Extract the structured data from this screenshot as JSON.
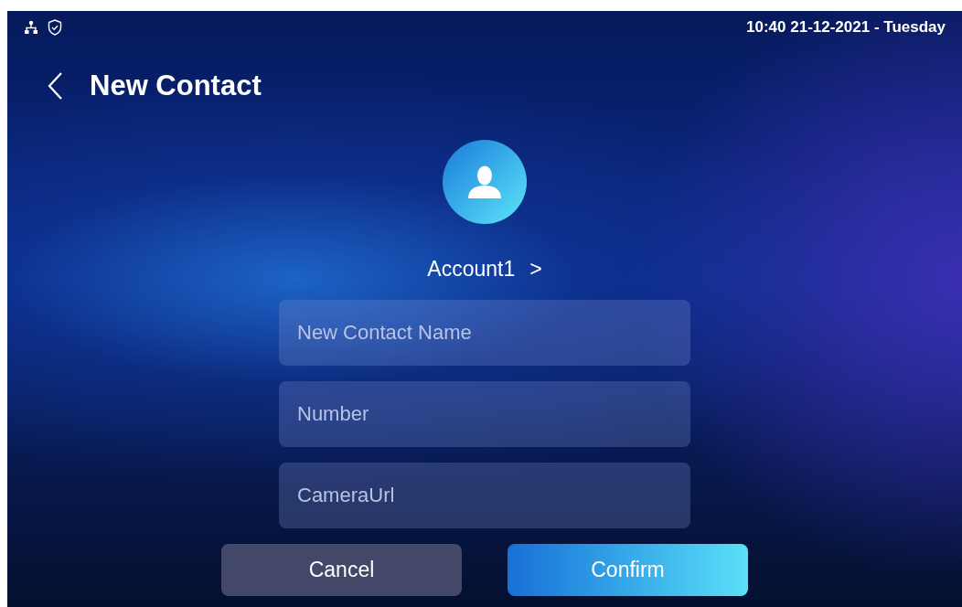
{
  "status_bar": {
    "datetime": "10:40  21-12-2021 - Tuesday"
  },
  "header": {
    "title": "New Contact"
  },
  "account": {
    "label": "Account1",
    "arrow": ">"
  },
  "fields": [
    {
      "placeholder": "New Contact Name"
    },
    {
      "placeholder": "Number"
    },
    {
      "placeholder": "CameraUrl"
    }
  ],
  "buttons": [
    {
      "label": "Cancel",
      "kind": "secondary"
    },
    {
      "label": "Confirm",
      "kind": "primary"
    }
  ]
}
